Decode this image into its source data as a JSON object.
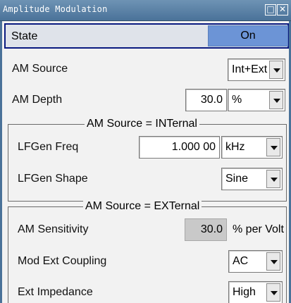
{
  "window": {
    "title": "Amplitude Modulation",
    "maximize_glyph": "□",
    "close_glyph": "✕"
  },
  "state": {
    "label": "State",
    "value": "On",
    "active_color": "#6c94d6"
  },
  "am_source": {
    "label": "AM Source",
    "value": "Int+Ext"
  },
  "am_depth": {
    "label": "AM Depth",
    "value": "30.0",
    "unit": "%"
  },
  "internal_group": {
    "legend": "AM Source = INTernal",
    "lfgen_freq": {
      "label": "LFGen Freq",
      "value": "1.000 00",
      "unit": "kHz"
    },
    "lfgen_shape": {
      "label": "LFGen Shape",
      "value": "Sine"
    }
  },
  "external_group": {
    "legend": "AM Source = EXTernal",
    "am_sensitivity": {
      "label": "AM Sensitivity",
      "value": "30.0",
      "unit": "% per Volt"
    },
    "mod_ext_coupling": {
      "label": "Mod Ext Coupling",
      "value": "AC"
    },
    "ext_impedance": {
      "label": "Ext Impedance",
      "value": "High"
    }
  },
  "icons": [
    "chevron-down-icon",
    "maximize-icon",
    "close-icon"
  ]
}
